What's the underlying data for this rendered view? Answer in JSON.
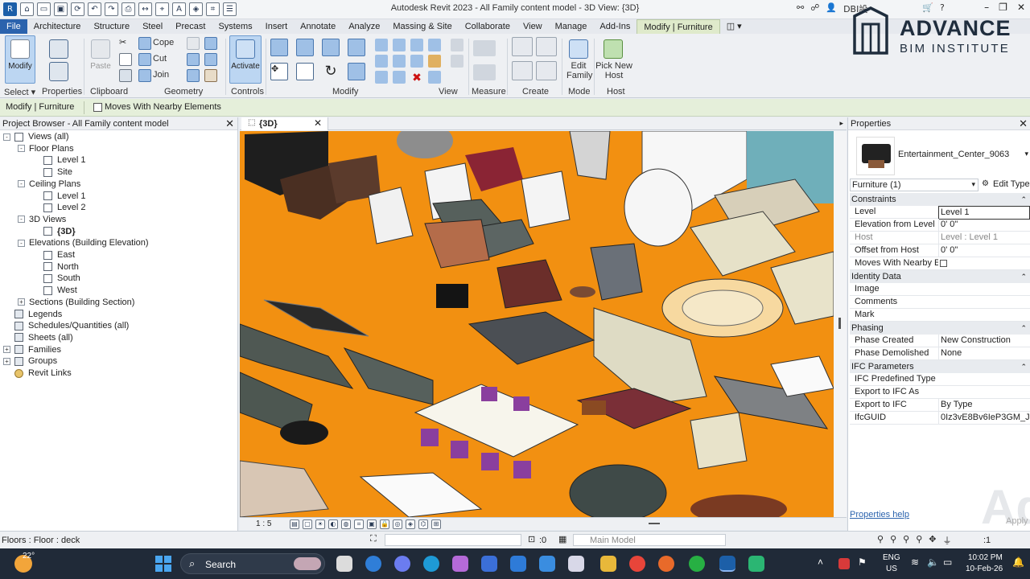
{
  "window": {
    "title": "Autodesk Revit 2023 - All Family content model - 3D View: {3D}",
    "user": "DBI設"
  },
  "tabs": [
    "File",
    "Architecture",
    "Structure",
    "Steel",
    "Precast",
    "Systems",
    "Insert",
    "Annotate",
    "Analyze",
    "Massing & Site",
    "Collaborate",
    "View",
    "Manage",
    "Add-Ins",
    "Modify | Furniture"
  ],
  "ribbon": {
    "modify_label": "Modify",
    "select_label": "Select",
    "properties_label": "Properties",
    "clipboard": {
      "paste": "Paste",
      "cope": "Cope",
      "cut": "Cut",
      "join": "Join",
      "label": "Clipboard"
    },
    "geometry_label": "Geometry",
    "activate_label": "Activate",
    "controls_label": "Controls",
    "modify_group_label": "Modify",
    "view_label": "View",
    "measure_label": "Measure",
    "create_label": "Create",
    "edit_family": "Edit Family",
    "pick_new_host": "Pick New Host",
    "mode_label": "Mode",
    "host_label": "Host"
  },
  "optbar": {
    "context": "Modify | Furniture",
    "moves_with_nearby": "Moves With Nearby Elements"
  },
  "logo": {
    "line1": "ADVANCE",
    "line2": "BIM INSTITUTE"
  },
  "project_browser": {
    "title": "Project Browser - All Family content model",
    "items": [
      {
        "label": "Views (all)",
        "level": 0,
        "exp": "-",
        "icon": "views"
      },
      {
        "label": "Floor Plans",
        "level": 1,
        "exp": "-"
      },
      {
        "label": "Level 1",
        "level": 2,
        "icon": "view"
      },
      {
        "label": "Site",
        "level": 2,
        "icon": "view"
      },
      {
        "label": "Ceiling Plans",
        "level": 1,
        "exp": "-"
      },
      {
        "label": "Level 1",
        "level": 2,
        "icon": "view"
      },
      {
        "label": "Level 2",
        "level": 2,
        "icon": "view"
      },
      {
        "label": "3D Views",
        "level": 1,
        "exp": "-"
      },
      {
        "label": "{3D}",
        "level": 2,
        "icon": "view",
        "bold": true
      },
      {
        "label": "Elevations (Building Elevation)",
        "level": 1,
        "exp": "-"
      },
      {
        "label": "East",
        "level": 2,
        "icon": "view"
      },
      {
        "label": "North",
        "level": 2,
        "icon": "view"
      },
      {
        "label": "South",
        "level": 2,
        "icon": "view"
      },
      {
        "label": "West",
        "level": 2,
        "icon": "view"
      },
      {
        "label": "Sections (Building Section)",
        "level": 1,
        "exp": "+"
      },
      {
        "label": "Legends",
        "level": 0,
        "icon": "grid"
      },
      {
        "label": "Schedules/Quantities (all)",
        "level": 0,
        "icon": "grid"
      },
      {
        "label": "Sheets (all)",
        "level": 0,
        "icon": "grid"
      },
      {
        "label": "Families",
        "level": 0,
        "exp": "+",
        "icon": "grid"
      },
      {
        "label": "Groups",
        "level": 0,
        "exp": "+",
        "icon": "grid"
      },
      {
        "label": "Revit Links",
        "level": 0,
        "icon": "link"
      }
    ]
  },
  "view": {
    "tab_label": "{3D}",
    "scale": "1 : 5"
  },
  "properties": {
    "title": "Properties",
    "type_name": "Entertainment_Center_9063",
    "filter": "Furniture (1)",
    "edit_type": "Edit Type",
    "sections": [
      {
        "name": "Constraints",
        "rows": [
          {
            "k": "Level",
            "v": "Level 1"
          },
          {
            "k": "Elevation from Level",
            "v": "0'  0\""
          },
          {
            "k": "Host",
            "v": "Level : Level 1"
          },
          {
            "k": "Offset from Host",
            "v": "0'  0\""
          },
          {
            "k": "Moves With Nearby E...",
            "v": ""
          }
        ]
      },
      {
        "name": "Identity Data",
        "rows": [
          {
            "k": "Image",
            "v": ""
          },
          {
            "k": "Comments",
            "v": ""
          },
          {
            "k": "Mark",
            "v": ""
          }
        ]
      },
      {
        "name": "Phasing",
        "rows": [
          {
            "k": "Phase Created",
            "v": "New Construction"
          },
          {
            "k": "Phase Demolished",
            "v": "None"
          }
        ]
      },
      {
        "name": "IFC Parameters",
        "rows": [
          {
            "k": "IFC Predefined Type",
            "v": ""
          },
          {
            "k": "Export to IFC As",
            "v": ""
          },
          {
            "k": "Export to IFC",
            "v": "By Type"
          },
          {
            "k": "IfcGUID",
            "v": "0Iz3vE8Bv6IeP3GM_J5..."
          }
        ]
      }
    ],
    "help": "Properties help",
    "apply": "Apply",
    "watermark": "Adv"
  },
  "status": {
    "text": "Floors : Floor : deck",
    "zero": ":0",
    "model": "Main Model",
    "filter_count": ":1"
  },
  "taskbar": {
    "temp": "22°",
    "search": "Search",
    "lang1": "ENG",
    "lang2": "US",
    "time": "10:02 PM",
    "date": "10-Feb-26"
  }
}
